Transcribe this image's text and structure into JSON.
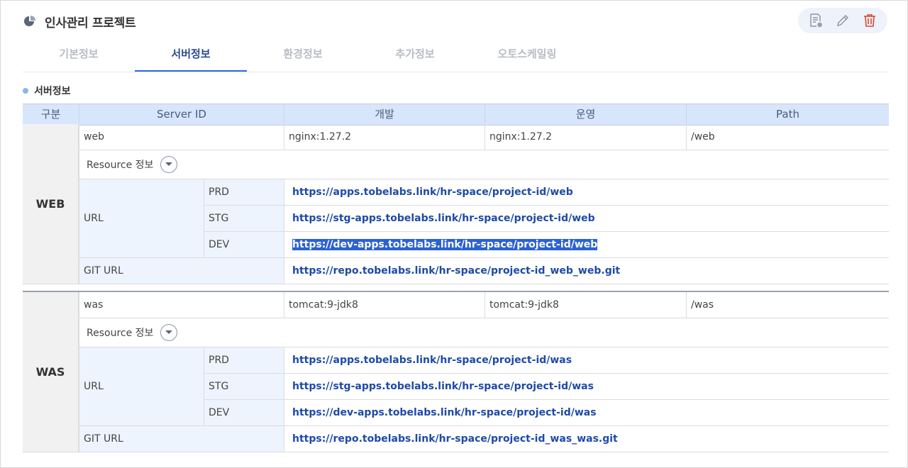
{
  "header": {
    "title": "인사관리 프로젝트",
    "icon": "pie-chart-icon"
  },
  "toolbar": {
    "icons": [
      "document-settings-icon",
      "edit-pencil-icon",
      "trash-icon"
    ],
    "delete_color": "#e0462f"
  },
  "tabs": [
    {
      "label": "기본정보",
      "active": false
    },
    {
      "label": "서버정보",
      "active": true
    },
    {
      "label": "환경정보",
      "active": false
    },
    {
      "label": "추가정보",
      "active": false
    },
    {
      "label": "오토스케일링",
      "active": false
    }
  ],
  "section": {
    "title": "서버정보"
  },
  "table": {
    "columns": [
      "구분",
      "Server ID",
      "개발",
      "운영",
      "Path"
    ],
    "resource_label": "Resource 정보",
    "url_label": "URL",
    "git_url_label": "GIT URL",
    "env_labels": [
      "PRD",
      "STG",
      "DEV"
    ],
    "groups": [
      {
        "name": "WEB",
        "server_id": "web",
        "dev": "nginx:1.27.2",
        "prod": "nginx:1.27.2",
        "path": "/web",
        "urls": {
          "prd": "https://apps.tobelabs.link/hr-space/project-id/web",
          "stg": "https://stg-apps.tobelabs.link/hr-space/project-id/web",
          "dev": "https://dev-apps.tobelabs.link/hr-space/project-id/web"
        },
        "git_url": "https://repo.tobelabs.link/hr-space/project-id_web_web.git"
      },
      {
        "name": "WAS",
        "server_id": "was",
        "dev": "tomcat:9-jdk8",
        "prod": "tomcat:9-jdk8",
        "path": "/was",
        "urls": {
          "prd": "https://apps.tobelabs.link/hr-space/project-id/was",
          "stg": "https://stg-apps.tobelabs.link/hr-space/project-id/was",
          "dev": "https://dev-apps.tobelabs.link/hr-space/project-id/was"
        },
        "git_url": "https://repo.tobelabs.link/hr-space/project-id_was_was.git"
      }
    ]
  }
}
